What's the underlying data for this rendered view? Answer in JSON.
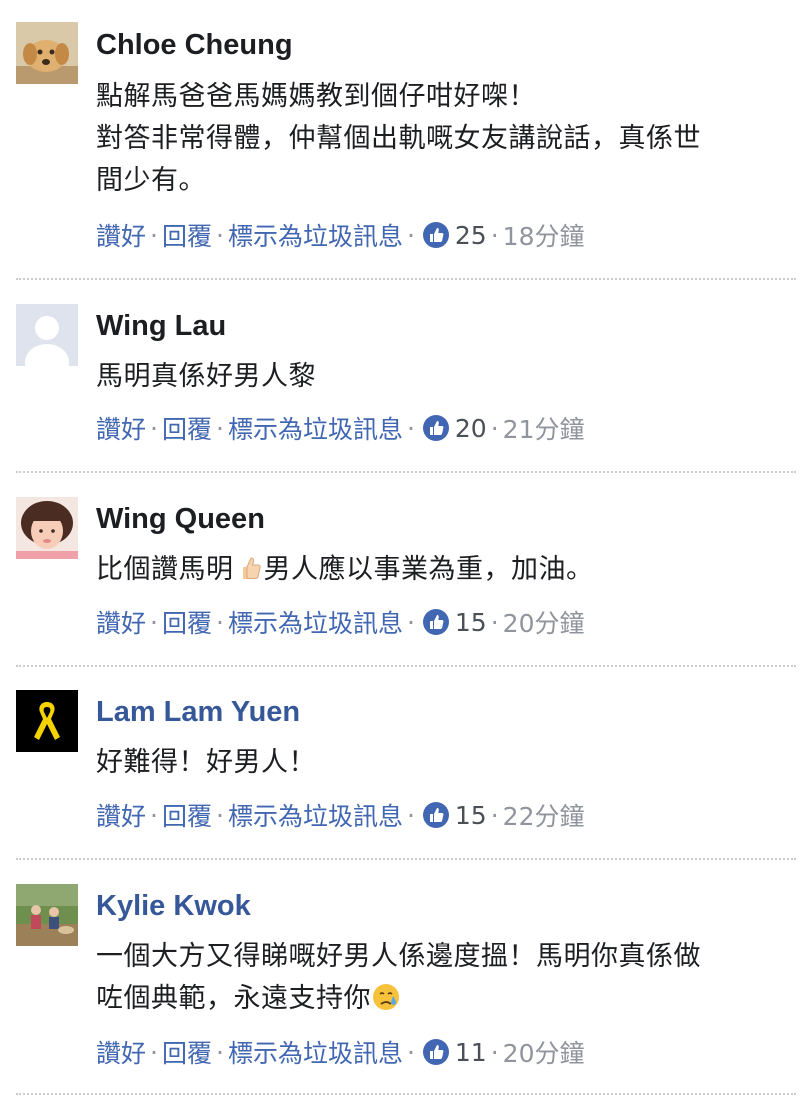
{
  "actions": {
    "like": "讚好",
    "reply": "回覆",
    "mark_spam": "標示為垃圾訊息",
    "separator": "·"
  },
  "comments": [
    {
      "author": "Chloe Cheung",
      "avatar": "dog-photo-icon",
      "lines": [
        "點解馬爸爸馬媽媽教到個仔咁好㗎！",
        "對答非常得體，仲幫個出軌嘅女友講說話，真係世",
        "間少有。"
      ],
      "likes": "25",
      "time": "18分鐘"
    },
    {
      "author": "Wing Lau",
      "avatar": "default-avatar-icon",
      "lines": [
        "馬明真係好男人黎"
      ],
      "likes": "20",
      "time": "21分鐘"
    },
    {
      "author": "Wing Queen",
      "avatar": "profile-photo-woman-icon",
      "line_before_emoji": "比個讚馬明",
      "emoji": "thumbs-up-emoji",
      "line_after_emoji": "男人應以事業為重，加油。",
      "likes": "15",
      "time": "20分鐘"
    },
    {
      "author": "Lam Lam Yuen",
      "avatar": "yellow-ribbon-icon",
      "lines": [
        "好難得！好男人！"
      ],
      "likes": "15",
      "time": "22分鐘"
    },
    {
      "author": "Kylie Kwok",
      "avatar": "outdoor-group-photo-icon",
      "lines": [
        "一個大方又得睇嘅好男人係邊度搵！馬明你真係做"
      ],
      "line_before_emoji": "咗個典範，永遠支持你",
      "emoji": "crying-face-emoji",
      "likes": "11",
      "time": "20分鐘"
    }
  ],
  "colors": {
    "link": "#4267b2",
    "name_link": "#365899",
    "muted": "#90949c",
    "like_badge": "#4267b2"
  }
}
